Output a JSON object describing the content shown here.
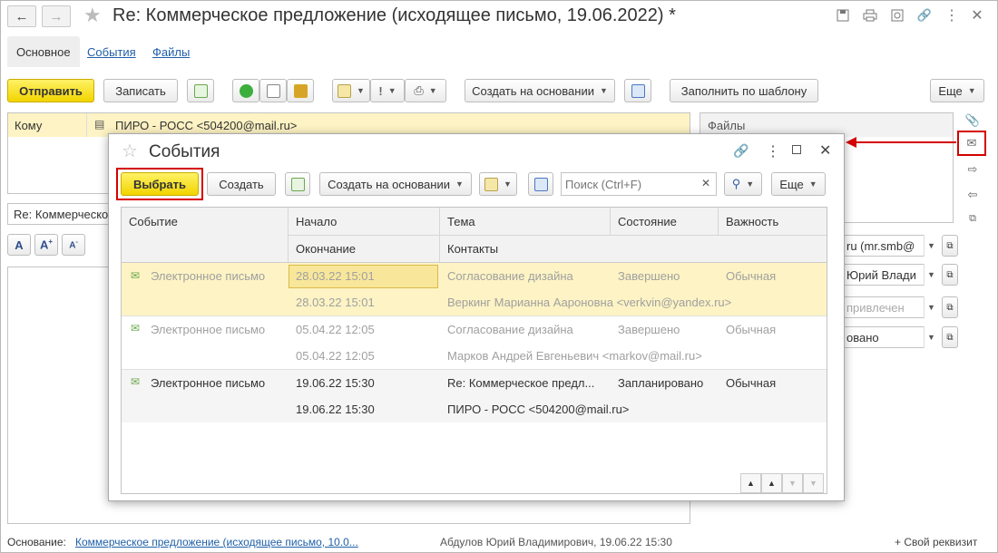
{
  "window": {
    "title": "Re: Коммерческое предложение (исходящее письмо, 19.06.2022) *"
  },
  "tabs": [
    {
      "label": "Основное"
    },
    {
      "label": "События"
    },
    {
      "label": "Файлы"
    }
  ],
  "toolbar": {
    "send_label": "Отправить",
    "save_label": "Записать",
    "create_based_label": "Создать на основании",
    "fill_template_label": "Заполнить по шаблону",
    "more_label": "Еще"
  },
  "form": {
    "to_label": "Кому",
    "to_value": "ПИРО - РОСС <504200@mail.ru>",
    "subject_value": "Re: Коммерческое",
    "files_label": "Файлы",
    "right_fields": [
      "ru (mr.smb@",
      "Юрий Влади",
      "привлечен",
      "овано"
    ]
  },
  "footer": {
    "basis_label": "Основание:",
    "basis_link": "Коммерческое предложение (исходящее письмо, 10.0...",
    "author": "Абдулов Юрий Владимирович, 19.06.22 15:30",
    "own_attr": "+ Свой реквизит"
  },
  "modal": {
    "title": "События",
    "select_label": "Выбрать",
    "create_label": "Создать",
    "create_based_label": "Создать на основании",
    "search_placeholder": "Поиск (Ctrl+F)",
    "more_label": "Еще",
    "columns": {
      "event": "Событие",
      "start": "Начало",
      "end": "Окончание",
      "topic": "Тема",
      "contacts": "Контакты",
      "state": "Состояние",
      "importance": "Важность"
    },
    "rows": [
      {
        "event": "Электронное письмо",
        "start": "28.03.22 15:01",
        "end": "28.03.22 15:01",
        "topic": "Согласование дизайна",
        "contacts": "Веркинг Марианна Аароновна <verkvin@yandex.ru>",
        "state": "Завершено",
        "importance": "Обычная"
      },
      {
        "event": "Электронное письмо",
        "start": "05.04.22 12:05",
        "end": "05.04.22 12:05",
        "topic": "Согласование дизайна",
        "contacts": "Марков Андрей Евгеньевич <markov@mail.ru>",
        "state": "Завершено",
        "importance": "Обычная"
      },
      {
        "event": "Электронное письмо",
        "start": "19.06.22 15:30",
        "end": "19.06.22 15:30",
        "topic": "Re: Коммерческое предл...",
        "contacts": "ПИРО - РОСС <504200@mail.ru>",
        "state": "Запланировано",
        "importance": "Обычная"
      }
    ]
  },
  "colors": {
    "accent_yellow": "#f2d400",
    "selection": "#fdf3c4",
    "link": "#1f5fa8",
    "highlight_red": "#d50000"
  }
}
